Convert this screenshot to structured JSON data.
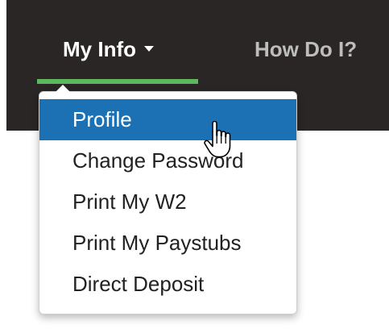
{
  "navbar": {
    "items": [
      {
        "label": "My Info",
        "active": true
      },
      {
        "label": "How Do I?",
        "active": false
      }
    ],
    "background": "#2b2626",
    "active_underline_color": "#5cb85c"
  },
  "dropdown": {
    "items": [
      {
        "label": "Profile",
        "highlighted": true
      },
      {
        "label": "Change Password",
        "highlighted": false
      },
      {
        "label": "Print My W2",
        "highlighted": false
      },
      {
        "label": "Print My Paystubs",
        "highlighted": false
      },
      {
        "label": "Direct Deposit",
        "highlighted": false
      }
    ],
    "highlight_color": "#1c71b5"
  },
  "cursor": {
    "icon": "hand-pointer-icon"
  }
}
